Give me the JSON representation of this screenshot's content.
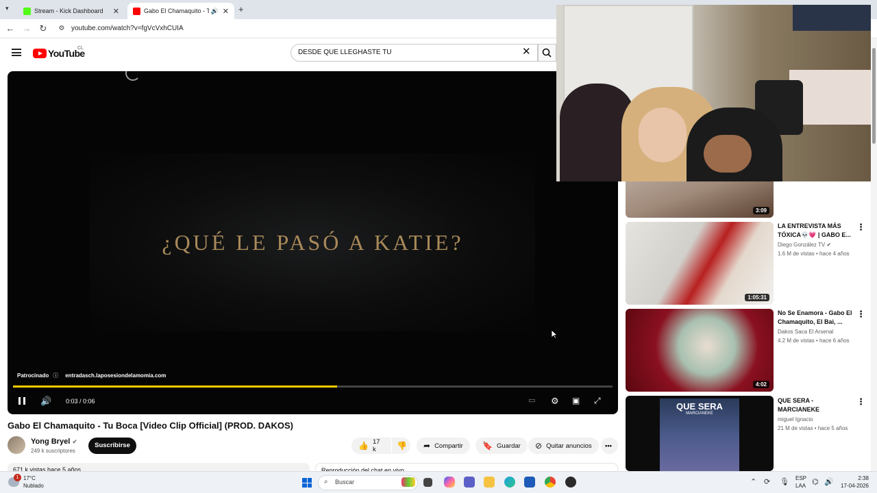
{
  "browser": {
    "tabs": [
      {
        "title": "Stream - Kick Dashboard",
        "favicon_color": "#53fc18"
      },
      {
        "title": "Gabo El Chamaquito - Tu Bo",
        "favicon_color": "#ff0000"
      }
    ],
    "new_tab": "+",
    "url": "youtube.com/watch?v=fgVcVxhCUIA"
  },
  "youtube": {
    "logo_text": "YouTube",
    "region": "CL",
    "search_value": "DESDE QUE LLEGHASTE TU"
  },
  "player": {
    "video_text": "¿QUÉ LE PASÓ A KATIE?",
    "sponsor_label": "Patrocinado",
    "sponsor_url": "entradasch.laposesiondelamomia.com",
    "time": "0:03 / 0:06",
    "progress": 0.54,
    "accent": "#ffcc00"
  },
  "video": {
    "title": "Gabo El Chamaquito - Tu Boca [Video Clip Official] (PROD. DAKOS)",
    "channel": "Yong Bryel",
    "subscribers": "249 k suscriptores",
    "subscribe_label": "Suscribirse",
    "likes": "17 k",
    "share_label": "Compartir",
    "save_label": "Guardar",
    "remove_ads_label": "Quitar anuncios",
    "description_preview": "671 k vistas  hace 5 años",
    "chat_replay": "Reproducción del chat en vivo"
  },
  "related": [
    {
      "duration": "3:09",
      "title": "",
      "channel": "",
      "meta": ""
    },
    {
      "duration": "1:05:31",
      "title": "LA ENTREVISTA MÁS TÓXICA💀💗 | GABO E...",
      "channel": "Diego González TV",
      "meta": "1.6 M de vistas • hace 4 años"
    },
    {
      "duration": "4:02",
      "title": "No Se  Enamora - Gabo El Chamaquito, El Bai, ...",
      "channel": "Dakos Saca El Arsenal",
      "meta": "4.2 M de vistas • hace 6 años"
    },
    {
      "duration": "",
      "title": "QUE SERA - MARCIANEKE",
      "channel": "miguel Ignacio",
      "meta": "21 M de vistas • hace 5 años",
      "thumb_text": "QUE SERA",
      "thumb_subtext": "MARCIANEKE"
    }
  ],
  "taskbar": {
    "weather_temp": "17°C",
    "weather_desc": "Nublado",
    "weather_badge": "1",
    "search_placeholder": "Buscar",
    "lang_top": "ESP",
    "lang_bottom": "LAA",
    "time": "2:38",
    "date": "17-04-2026"
  }
}
